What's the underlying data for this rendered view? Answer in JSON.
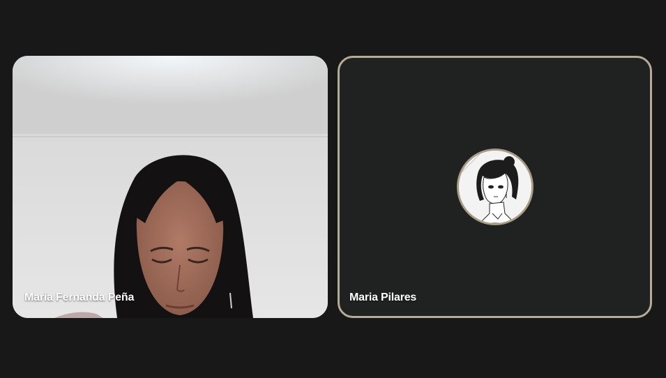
{
  "participants": [
    {
      "name": "Maria Fernanda Peña",
      "video": "camera-on"
    },
    {
      "name": "Maria Pilares",
      "video": "camera-off-avatar"
    }
  ],
  "colors": {
    "background": "#181818",
    "tile_off": "#202221",
    "active_speaker_border": "#b5ab97"
  },
  "icons": {
    "avatar": "anime-portrait-avatar"
  }
}
